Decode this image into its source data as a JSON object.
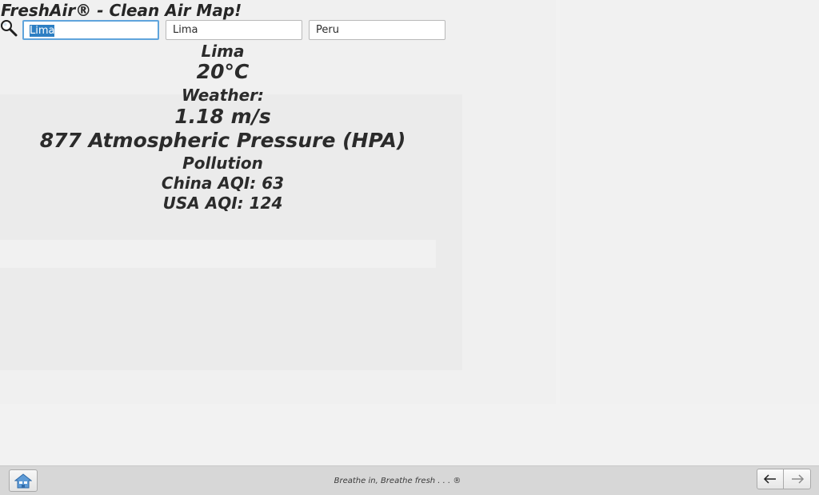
{
  "app": {
    "title": "FreshAir® - Clean Air Map!"
  },
  "search": {
    "icon": "search-icon",
    "query_selected": "Lima",
    "city_value": "Lima",
    "country_value": "Peru"
  },
  "info": {
    "city": "Lima",
    "temperature": "20°C",
    "weather_label": "Weather:",
    "wind_speed": "1.18 m/s",
    "pressure": "877 Atmospheric Pressure (HPA)",
    "pollution_label": "Pollution",
    "china_aqi": "China AQI: 63",
    "usa_aqi": "USA AQI: 124"
  },
  "footer": {
    "home_icon": "home-icon",
    "tagline": "Breathe in, Breathe fresh . . . ®",
    "back_icon": "arrow-left-icon",
    "forward_icon": "arrow-right-icon"
  },
  "colors": {
    "selection": "#2d7fc3",
    "focus_border": "#5fa4dc",
    "footer_bg": "#d7d7d7",
    "home_icon": "#3b7fc4"
  }
}
